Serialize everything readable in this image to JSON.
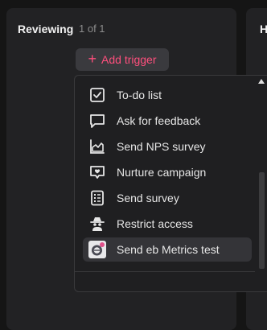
{
  "column": {
    "title": "Reviewing",
    "count": "1 of 1"
  },
  "next_column": {
    "title": "H"
  },
  "add_trigger": {
    "icon": "plus-icon",
    "label": "Add trigger",
    "color": "#ff4f7d"
  },
  "menu": {
    "items": [
      {
        "label": "To-do list",
        "icon": "checkbox-icon"
      },
      {
        "label": "Ask for feedback",
        "icon": "chat-bubble-icon"
      },
      {
        "label": "Send NPS survey",
        "icon": "area-chart-icon"
      },
      {
        "label": "Nurture campaign",
        "icon": "heart-message-icon"
      },
      {
        "label": "Send survey",
        "icon": "checklist-icon"
      },
      {
        "label": "Restrict access",
        "icon": "spy-icon"
      },
      {
        "label": "Send eb Metrics test",
        "icon": "app-logo-icon",
        "highlighted": true
      }
    ]
  }
}
